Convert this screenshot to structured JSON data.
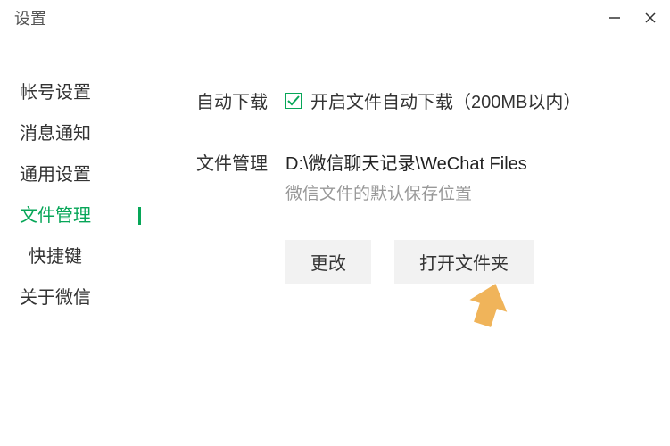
{
  "window": {
    "title": "设置"
  },
  "sidebar": {
    "items": [
      {
        "label": "帐号设置",
        "active": false,
        "sub": false
      },
      {
        "label": "消息通知",
        "active": false,
        "sub": false
      },
      {
        "label": "通用设置",
        "active": false,
        "sub": false
      },
      {
        "label": "文件管理",
        "active": true,
        "sub": false
      },
      {
        "label": "快捷键",
        "active": false,
        "sub": true
      },
      {
        "label": "关于微信",
        "active": false,
        "sub": false
      }
    ]
  },
  "main": {
    "auto_download": {
      "label": "自动下载",
      "checkbox_checked": true,
      "checkbox_text": "开启文件自动下载（200MB以内）"
    },
    "file_manage": {
      "label": "文件管理",
      "path": "D:\\微信聊天记录\\WeChat Files",
      "hint": "微信文件的默认保存位置"
    },
    "buttons": {
      "change": "更改",
      "open_folder": "打开文件夹"
    }
  }
}
